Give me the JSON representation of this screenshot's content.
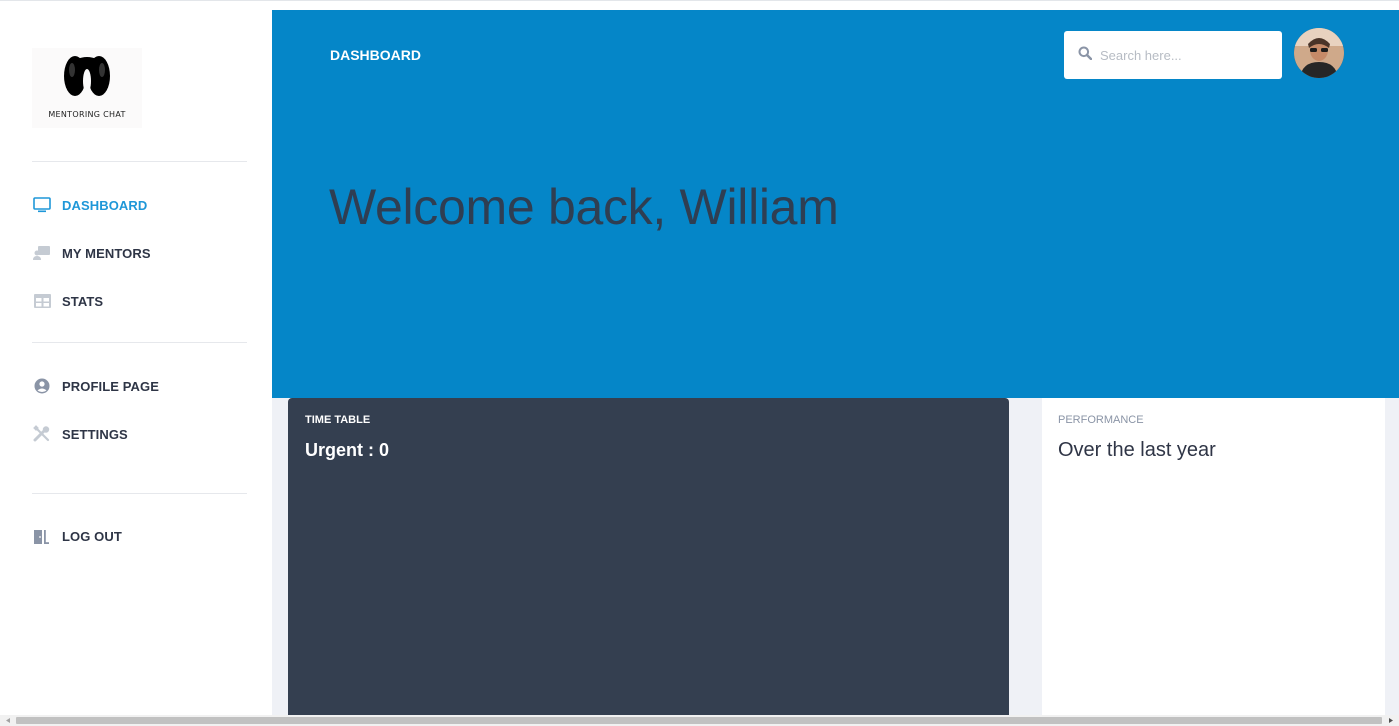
{
  "app": {
    "logo_text": "MENTORING CHAT"
  },
  "sidebar": {
    "items": [
      {
        "label": "DASHBOARD",
        "icon": "monitor-icon",
        "active": true
      },
      {
        "label": "MY MENTORS",
        "icon": "chalkboard-teacher-icon"
      },
      {
        "label": "STATS",
        "icon": "table-icon"
      },
      {
        "label": "PROFILE PAGE",
        "icon": "user-circle-icon"
      },
      {
        "label": "SETTINGS",
        "icon": "tools-icon"
      },
      {
        "label": "LOG OUT",
        "icon": "door-open-icon"
      }
    ]
  },
  "header": {
    "title": "DASHBOARD",
    "search_placeholder": "Search here...",
    "avatar": "user-avatar"
  },
  "hero": {
    "welcome": "Welcome back, William"
  },
  "cards": {
    "timetable": {
      "label": "TIME TABLE",
      "value": "Urgent : 0"
    },
    "performance": {
      "label": "PERFORMANCE",
      "value": "Over the last year"
    }
  },
  "colors": {
    "primary": "#0586c8",
    "active_nav": "#1e97d8",
    "dark_card": "#343f50",
    "content_bg": "#eff1f6",
    "text_dark": "#2e3546"
  }
}
